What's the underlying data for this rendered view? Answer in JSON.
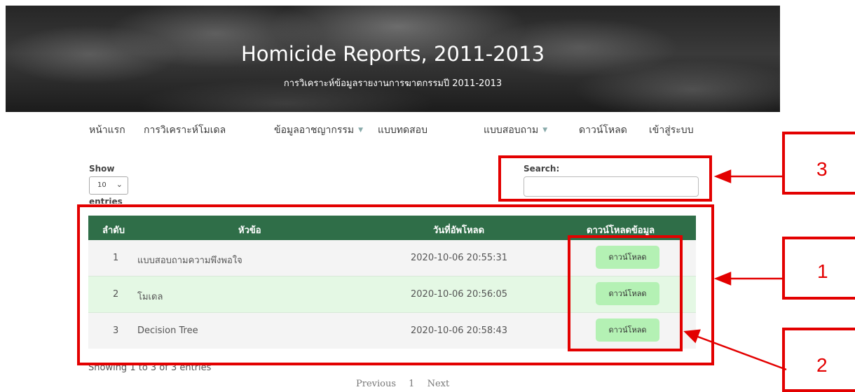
{
  "banner": {
    "title": "Homicide Reports, 2011-2013",
    "subtitle": "การวิเคราะห์ข้อมูลรายงานการฆาตกรรมปี 2011-2013"
  },
  "nav": [
    {
      "label": "หน้าแรก",
      "dropdown": false
    },
    {
      "label": "การวิเคราะห์โมเดล",
      "dropdown": false
    },
    {
      "label": "ข้อมูลอาชญากรรม",
      "dropdown": true
    },
    {
      "label": "แบบทดสอบ",
      "dropdown": false
    },
    {
      "label": "แบบสอบถาม",
      "dropdown": true
    },
    {
      "label": "ดาวน์โหลด",
      "dropdown": false
    },
    {
      "label": "เข้าสู่ระบบ",
      "dropdown": false
    }
  ],
  "length_control": {
    "show_label": "Show",
    "selected": "10",
    "entries_label": "entries"
  },
  "search": {
    "label": "Search:",
    "value": "",
    "placeholder": ""
  },
  "table": {
    "columns": [
      "ลำดับ",
      "หัวข้อ",
      "วันที่อัพโหลด",
      "ดาวน์โหลดข้อมูล"
    ],
    "rows": [
      {
        "index": "1",
        "title": "แบบสอบถามความพึงพอใจ",
        "uploaded": "2020-10-06 20:55:31",
        "button": "ดาวน์โหลด"
      },
      {
        "index": "2",
        "title": "โมเดล",
        "uploaded": "2020-10-06 20:56:05",
        "button": "ดาวน์โหลด"
      },
      {
        "index": "3",
        "title": "Decision Tree",
        "uploaded": "2020-10-06 20:58:43",
        "button": "ดาวน์โหลด"
      }
    ]
  },
  "info": "Showing 1 to 3 of 3 entries",
  "pagination": {
    "previous": "Previous",
    "page": "1",
    "next": "Next"
  },
  "annotations": {
    "label_1": "1",
    "label_2": "2",
    "label_3": "3",
    "color": "#e30000"
  },
  "colors": {
    "table_header": "#2f6e48",
    "download_button": "#b4f1b4",
    "even_row": "#e4f8e4"
  }
}
